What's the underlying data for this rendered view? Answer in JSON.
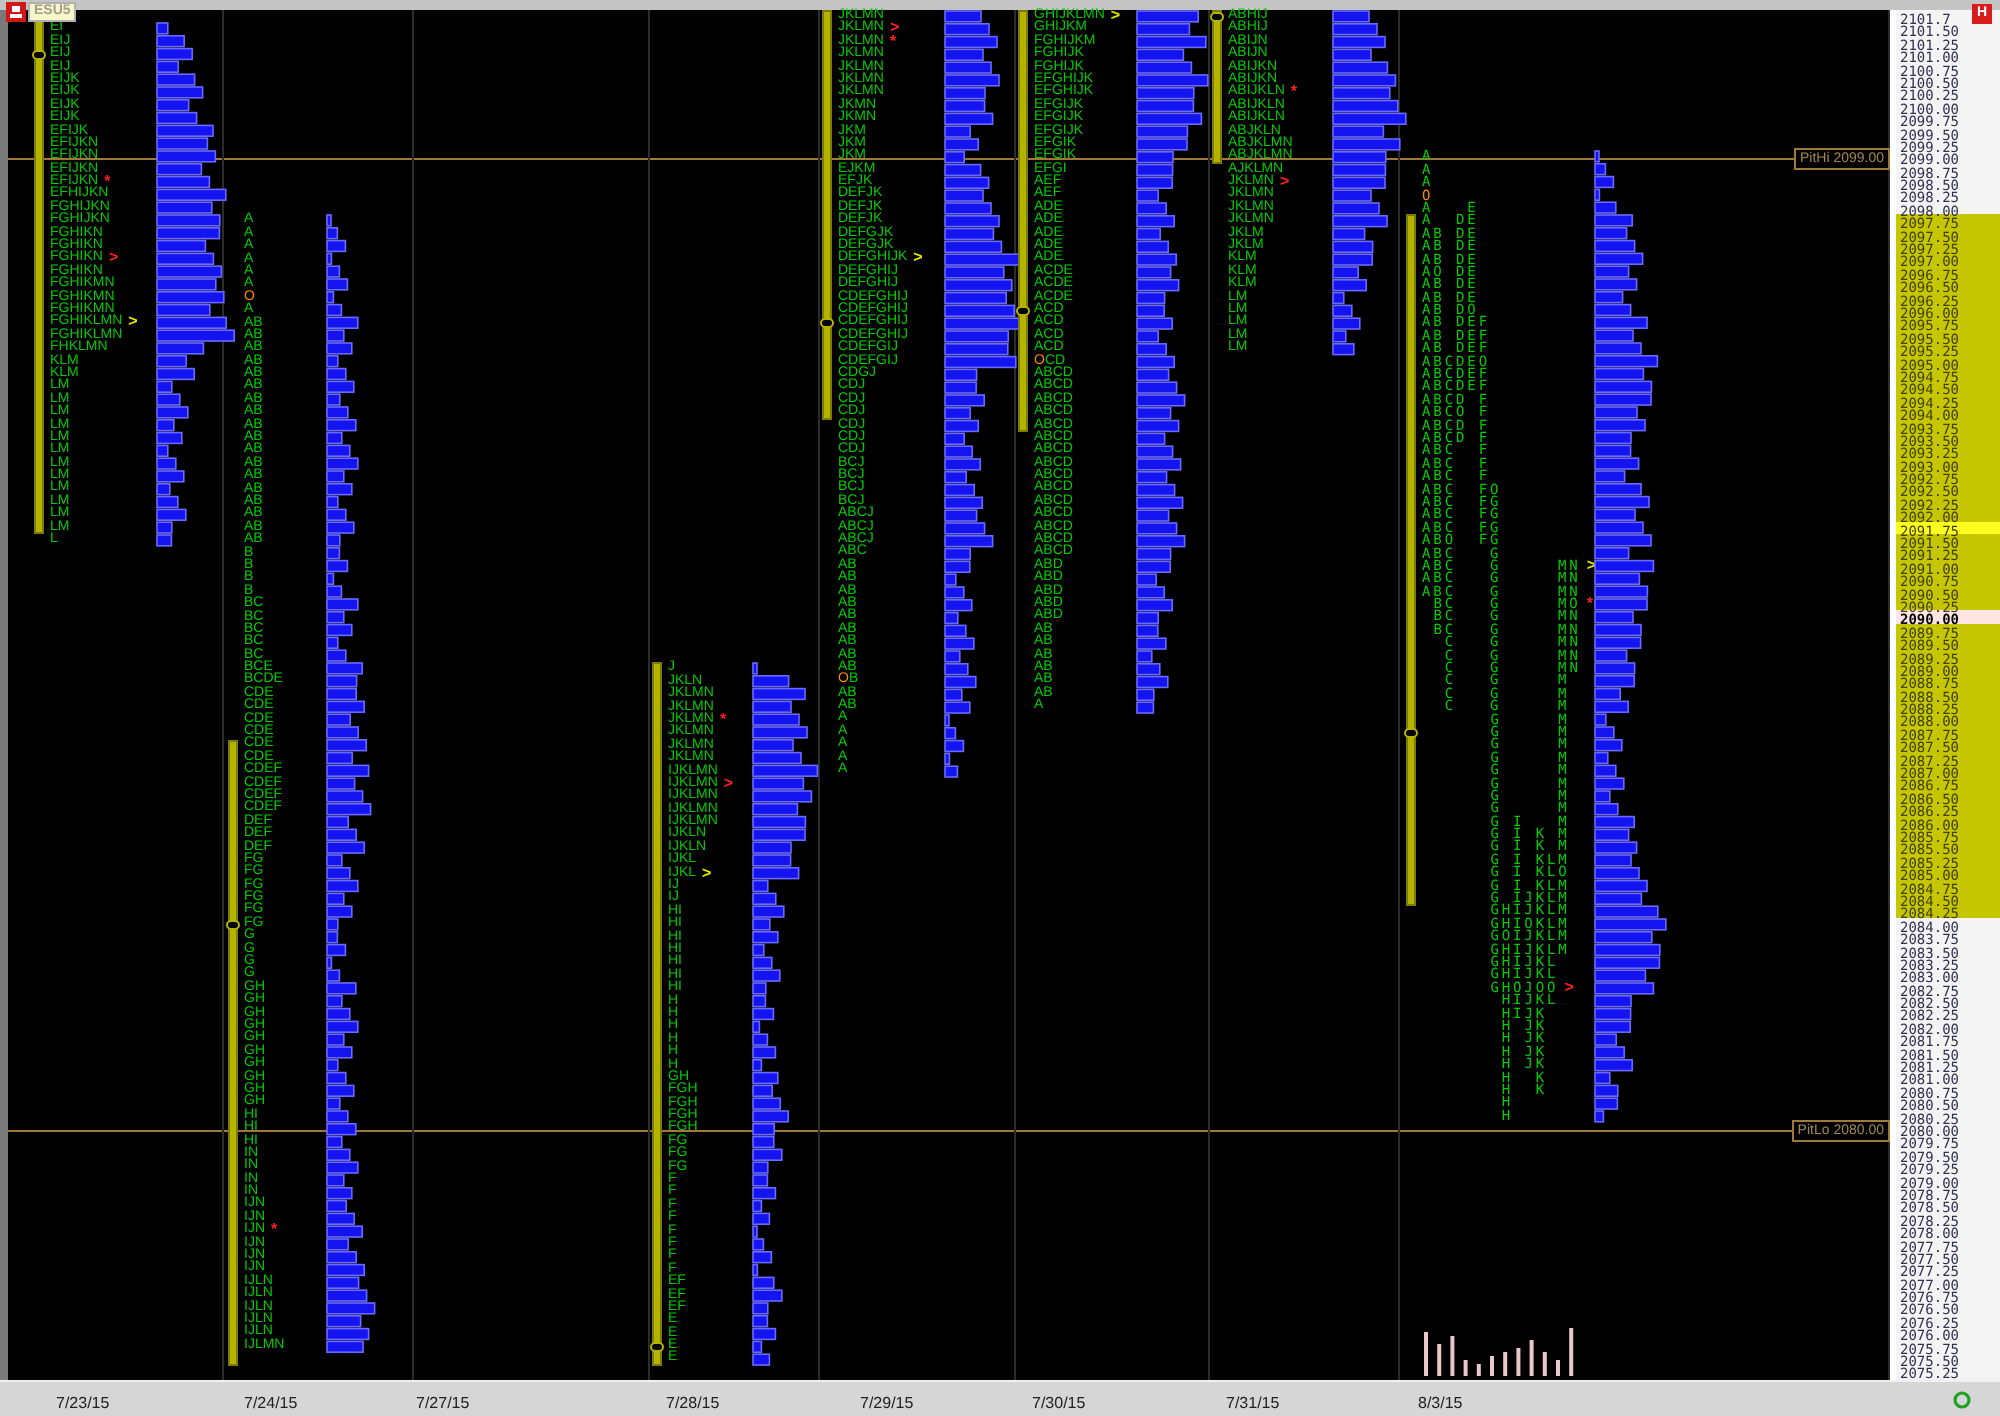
{
  "window": {
    "symbol": "ESU5",
    "button": "H"
  },
  "levels": [
    {
      "label": "PitHi 2099.00"
    },
    {
      "label": "PitLo 2080.00"
    }
  ],
  "days": [
    {
      "date": "7/23/15",
      "kind": "compact",
      "rows": [
        "EI",
        "EIJ",
        "EIJ",
        "EIJ",
        "EIJK",
        "EIJK",
        "EIJK",
        "EIJK",
        "EFIJK",
        "EFIJKN",
        "EFIJKN",
        "EFIJKN",
        {
          "tpo": "EFIJKN",
          "mark": "*",
          "color": "#ff2020"
        },
        "EFHIJKN",
        "FGHIJKN",
        "FGHIJKN",
        "FGHIKN",
        "FGHIKN",
        {
          "tpo": "FGHIKN",
          "mark": ">",
          "color": "#ff2020"
        },
        "FGHIKN",
        "FGHIKMN",
        "FGHIKMN",
        "FGHIKMN",
        {
          "tpo": "FGHIKLMN",
          "mark": ">",
          "color": "#e8e800"
        },
        "FGHIKLMN",
        "FHKLMN",
        "KLM",
        "KLM",
        "LM",
        "LM",
        "LM",
        "LM",
        "LM",
        "LM",
        "LM",
        "LM",
        "LM",
        "LM",
        "LM",
        "LM",
        "L"
      ]
    },
    {
      "date": "7/24/15",
      "kind": "compact",
      "rows": [
        "A",
        "A",
        "A",
        "A",
        "A",
        "A",
        {
          "tpo": "O",
          "open": true
        },
        "A",
        "AB",
        "AB",
        "AB",
        "AB",
        "AB",
        "AB",
        "AB",
        "AB",
        "AB",
        "AB",
        "AB",
        "AB",
        "AB",
        "AB",
        "AB",
        "AB",
        "AB",
        "AB",
        "B",
        "B",
        "B",
        "B",
        "BC",
        "BC",
        "BC",
        "BC",
        "BC",
        "BCE",
        "BCDE",
        "CDE",
        "CDE",
        "CDE",
        "CDE",
        "CDE",
        "CDE",
        "CDEF",
        "CDEF",
        "CDEF",
        "CDEF",
        "DEF",
        "DEF",
        "DEF",
        "FG",
        "FG",
        "FG",
        "FG",
        "FG",
        "FG",
        "G",
        "G",
        "G",
        "G",
        "GH",
        "GH",
        "GH",
        "GH",
        "GH",
        "GH",
        "GH",
        "GH",
        "GH",
        "GH",
        "HI",
        "HI",
        "HI",
        "IN",
        "IN",
        "IN",
        "IN",
        "IJN",
        "IJN",
        {
          "tpo": "IJN",
          "mark": "*",
          "color": "#ff2020"
        },
        "IJN",
        "IJN",
        "IJN",
        "IJLN",
        "IJLN",
        "IJLN",
        "IJLN",
        "IJLN",
        "IJLMN"
      ]
    },
    {
      "date": "7/27/15"
    },
    {
      "date": "7/28/15",
      "kind": "compact",
      "rows": [
        "J",
        "JKLN",
        "JKLMN",
        "JKLMN",
        {
          "tpo": "JKLMN",
          "mark": "*",
          "color": "#ff2020"
        },
        "JKLMN",
        "JKLMN",
        "JKLMN",
        "IJKLMN",
        {
          "tpo": "IJKLMN",
          "mark": ">",
          "color": "#ff2020"
        },
        "IJKLMN",
        "IJKLMN",
        "IJKLMN",
        "IJKLN",
        "IJKLN",
        "IJKL",
        {
          "tpo": "IJKL",
          "mark": ">",
          "color": "#e8e800"
        },
        "IJ",
        "IJ",
        "HI",
        "HI",
        "HI",
        "HI",
        "HI",
        "HI",
        "HI",
        "H",
        "H",
        "H",
        "H",
        "H",
        "H",
        "GH",
        "FGH",
        "FGH",
        "FGH",
        "FGH",
        "FG",
        "FG",
        "FG",
        "F",
        "F",
        "F",
        "F",
        "F",
        "F",
        "F",
        "F",
        "EF",
        "EF",
        "EF",
        "E",
        "E",
        "E",
        "E"
      ]
    },
    {
      "date": "7/29/15",
      "kind": "compact",
      "rows": [
        "JKLMN",
        {
          "tpo": "JKLMN",
          "mark": ">",
          "color": "#ff2020"
        },
        {
          "tpo": "JKLMN",
          "mark": "*",
          "color": "#ff2020"
        },
        "JKLMN",
        "JKLMN",
        "JKLMN",
        "JKLMN",
        "JKMN",
        "JKMN",
        "JKM",
        "JKM",
        "JKM",
        "EJKM",
        "EFJK",
        "DEFJK",
        "DEFJK",
        "DEFJK",
        "DEFGJK",
        "DEFGJK",
        {
          "tpo": "DEFGHIJK",
          "mark": ">",
          "color": "#e8e800"
        },
        "DEFGHIJ",
        "DEFGHIJ",
        "CDEFGHIJ",
        "CDEFGHIJ",
        "CDEFGHIJ",
        "CDEFGHIJ",
        "CDEFGIJ",
        "CDEFGIJ",
        "CDGJ",
        "CDJ",
        "CDJ",
        "CDJ",
        "CDJ",
        "CDJ",
        "CDJ",
        "BCJ",
        "BCJ",
        "BCJ",
        "BCJ",
        "ABCJ",
        "ABCJ",
        "ABCJ",
        "ABC",
        "AB",
        "AB",
        "AB",
        "AB",
        "AB",
        "AB",
        "AB",
        "AB",
        "AB",
        {
          "tpo": "OB",
          "open": true
        },
        "AB",
        "AB",
        "A",
        "A",
        "A",
        "A",
        "A"
      ]
    },
    {
      "date": "7/30/15",
      "kind": "compact",
      "rows": [
        {
          "tpo": "GHIJKLMN",
          "mark": ">",
          "color": "#e8e800"
        },
        "GHIJKM",
        "FGHIJKM",
        "FGHIJK",
        "FGHIJK",
        "EFGHIJK",
        "EFGHIJK",
        "EFGIJK",
        "EFGIJK",
        "EFGIJK",
        "EFGIK",
        "EFGIK",
        "EFGI",
        "AEF",
        "AEF",
        "ADE",
        "ADE",
        "ADE",
        "ADE",
        "ADE",
        "ACDE",
        "ACDE",
        "ACDE",
        "ACD",
        "ACD",
        "ACD",
        "ACD",
        {
          "tpo": "OCD",
          "open": true
        },
        "ABCD",
        "ABCD",
        "ABCD",
        "ABCD",
        "ABCD",
        "ABCD",
        "ABCD",
        "ABCD",
        "ABCD",
        "ABCD",
        "ABCD",
        "ABCD",
        "ABCD",
        "ABCD",
        "ABCD",
        "ABD",
        "ABD",
        "ABD",
        "ABD",
        "ABD",
        "AB",
        "AB",
        "AB",
        "AB",
        "AB",
        "AB",
        "A"
      ]
    },
    {
      "date": "7/31/15",
      "kind": "compact",
      "rows": [
        "ABHIJ",
        "ABHIJ",
        "ABIJN",
        "ABIJN",
        "ABIJKN",
        "ABIJKN",
        {
          "tpo": "ABIJKLN",
          "mark": "*",
          "color": "#ff2020"
        },
        "ABIJKLN",
        "ABIJKLN",
        "ABJKLN",
        "ABJKLMN",
        "ABJKLMN",
        "AJKLMN",
        {
          "tpo": "JKLMN",
          "mark": ">",
          "color": "#ff2020"
        },
        "JKLMN",
        "JKLMN",
        "JKLMN",
        "JKLM",
        "JKLM",
        "KLM",
        "KLM",
        "KLM",
        "LM",
        "LM",
        "LM",
        "LM",
        "LM"
      ]
    },
    {
      "date": "8/3/15",
      "kind": "columns",
      "volume_bars": true,
      "rows": [
        "A",
        "A",
        "A",
        {
          "tpo": "O",
          "open": true
        },
        "A   E",
        "A  DE",
        "AB DE",
        "AB DE",
        "AB DE",
        "AO DE",
        "AB DE",
        "AB DE",
        "AB DO",
        "AB DEF",
        "AB DEF",
        "AB DEF",
        "ABCDEO",
        "ABCDEF",
        "ABCDEF",
        "ABCD F",
        "ABCO F",
        "ABCD F",
        "ABCD F",
        "ABC  F",
        "ABC  F",
        "ABC  F",
        "ABC  FO",
        "ABC  FG",
        "ABC  FG",
        "ABC  FG",
        "ABO  FG",
        "ABC   G",
        {
          "tpo": "ABC   G     MN",
          "mark": ">",
          "color": "#e8e800"
        },
        "ABC   G     MN",
        "ABC   G     MN",
        {
          "tpo": " BC   G     MO",
          "mark": "*",
          "color": "#ff2020"
        },
        " BC   G     MN",
        " BC   G     MN",
        "  C   G     MN",
        "  C   G     MN",
        "  C   G     MN",
        "  C   G     M",
        "  C   G     M",
        "  C   G     M",
        "      G     M",
        "      G     M",
        "      G     M",
        "      G     M",
        "      G     M",
        "      G     M",
        "      G     M",
        "      G     M",
        "      G I   M",
        "      G I K M",
        "      G I K M",
        "      G I KLM",
        "      G I KLO",
        "      G I KLM",
        "      G IJKLM",
        "      GHIJKLM",
        "      GHIOKLM",
        "      GOIJKLM",
        "      GHIJKLM",
        "      GHIJKL",
        "      GHIJKL",
        {
          "tpo": "      GHOJOO",
          "mark": ">",
          "color": "#ff2020"
        },
        "       HIJKL",
        "       HIJK",
        "       H JK",
        "       H JK",
        "       H JK",
        "       H JK",
        "       H  K",
        "       H  K",
        "       H",
        "       H"
      ]
    }
  ],
  "axis": {
    "labels": [
      {
        "price": "2101.7",
        "kind": "plain"
      },
      {
        "price": "2101.50",
        "kind": "plain"
      },
      {
        "price": "2101.25",
        "kind": "plain"
      },
      {
        "price": "2101.00",
        "kind": "plain"
      },
      {
        "price": "2100.75",
        "kind": "plain"
      },
      {
        "price": "2100.50",
        "kind": "plain"
      },
      {
        "price": "2100.25",
        "kind": "plain"
      },
      {
        "price": "2100.00",
        "kind": "plain"
      },
      {
        "price": "2099.75",
        "kind": "plain"
      },
      {
        "price": "2099.50",
        "kind": "plain"
      },
      {
        "price": "2099.25",
        "kind": "plain"
      },
      {
        "price": "2099.00",
        "kind": "plain"
      },
      {
        "price": "2098.75",
        "kind": "plain"
      },
      {
        "price": "2098.50",
        "kind": "plain"
      },
      {
        "price": "2098.25",
        "kind": "plain"
      },
      {
        "price": "2098.00",
        "kind": "plain"
      },
      {
        "price": "2097.75",
        "kind": "value"
      },
      {
        "price": "2097.50",
        "kind": "value"
      },
      {
        "price": "2097.25",
        "kind": "value"
      },
      {
        "price": "2097.00",
        "kind": "value"
      },
      {
        "price": "2096.75",
        "kind": "value"
      },
      {
        "price": "2096.50",
        "kind": "value"
      },
      {
        "price": "2096.25",
        "kind": "value"
      },
      {
        "price": "2096.00",
        "kind": "value"
      },
      {
        "price": "2095.75",
        "kind": "value"
      },
      {
        "price": "2095.50",
        "kind": "value"
      },
      {
        "price": "2095.25",
        "kind": "value"
      },
      {
        "price": "2095.00",
        "kind": "value"
      },
      {
        "price": "2094.75",
        "kind": "value"
      },
      {
        "price": "2094.50",
        "kind": "value"
      },
      {
        "price": "2094.25",
        "kind": "value"
      },
      {
        "price": "2094.00",
        "kind": "value"
      },
      {
        "price": "2093.75",
        "kind": "value"
      },
      {
        "price": "2093.50",
        "kind": "value"
      },
      {
        "price": "2093.25",
        "kind": "value"
      },
      {
        "price": "2093.00",
        "kind": "value"
      },
      {
        "price": "2092.75",
        "kind": "value"
      },
      {
        "price": "2092.50",
        "kind": "value"
      },
      {
        "price": "2092.25",
        "kind": "value"
      },
      {
        "price": "2092.00",
        "kind": "value"
      },
      {
        "price": "2091.75",
        "kind": "bright"
      },
      {
        "price": "2091.50",
        "kind": "value"
      },
      {
        "price": "2091.25",
        "kind": "value"
      },
      {
        "price": "2091.00",
        "kind": "value"
      },
      {
        "price": "2090.75",
        "kind": "value"
      },
      {
        "price": "2090.50",
        "kind": "value"
      },
      {
        "price": "2090.25",
        "kind": "value"
      },
      {
        "price": "2090.00",
        "kind": "last"
      },
      {
        "price": "2089.75",
        "kind": "value"
      },
      {
        "price": "2089.50",
        "kind": "value"
      },
      {
        "price": "2089.25",
        "kind": "value"
      },
      {
        "price": "2089.00",
        "kind": "value"
      },
      {
        "price": "2088.75",
        "kind": "value"
      },
      {
        "price": "2088.50",
        "kind": "value"
      },
      {
        "price": "2088.25",
        "kind": "value"
      },
      {
        "price": "2088.00",
        "kind": "value"
      },
      {
        "price": "2087.75",
        "kind": "value"
      },
      {
        "price": "2087.50",
        "kind": "value"
      },
      {
        "price": "2087.25",
        "kind": "value"
      },
      {
        "price": "2087.00",
        "kind": "value"
      },
      {
        "price": "2086.75",
        "kind": "value"
      },
      {
        "price": "2086.50",
        "kind": "value"
      },
      {
        "price": "2086.25",
        "kind": "value"
      },
      {
        "price": "2086.00",
        "kind": "value"
      },
      {
        "price": "2085.75",
        "kind": "value"
      },
      {
        "price": "2085.50",
        "kind": "value"
      },
      {
        "price": "2085.25",
        "kind": "value"
      },
      {
        "price": "2085.00",
        "kind": "value"
      },
      {
        "price": "2084.75",
        "kind": "value"
      },
      {
        "price": "2084.50",
        "kind": "value"
      },
      {
        "price": "2084.25",
        "kind": "value"
      },
      {
        "price": "2084.00",
        "kind": "plain"
      },
      {
        "price": "2083.75",
        "kind": "plain"
      },
      {
        "price": "2083.50",
        "kind": "plain"
      },
      {
        "price": "2083.25",
        "kind": "plain"
      },
      {
        "price": "2083.00",
        "kind": "plain"
      },
      {
        "price": "2082.75",
        "kind": "plain"
      },
      {
        "price": "2082.50",
        "kind": "plain"
      },
      {
        "price": "2082.25",
        "kind": "plain"
      },
      {
        "price": "2082.00",
        "kind": "plain"
      },
      {
        "price": "2081.75",
        "kind": "plain"
      },
      {
        "price": "2081.50",
        "kind": "plain"
      },
      {
        "price": "2081.25",
        "kind": "plain"
      },
      {
        "price": "2081.00",
        "kind": "plain"
      },
      {
        "price": "2080.75",
        "kind": "plain"
      },
      {
        "price": "2080.50",
        "kind": "plain"
      },
      {
        "price": "2080.25",
        "kind": "plain"
      },
      {
        "price": "2080.00",
        "kind": "plain"
      },
      {
        "price": "2079.75",
        "kind": "plain"
      },
      {
        "price": "2079.50",
        "kind": "plain"
      },
      {
        "price": "2079.25",
        "kind": "plain"
      },
      {
        "price": "2079.00",
        "kind": "plain"
      },
      {
        "price": "2078.75",
        "kind": "plain"
      },
      {
        "price": "2078.50",
        "kind": "plain"
      },
      {
        "price": "2078.25",
        "kind": "plain"
      },
      {
        "price": "2078.00",
        "kind": "plain"
      },
      {
        "price": "2077.75",
        "kind": "plain"
      },
      {
        "price": "2077.50",
        "kind": "plain"
      },
      {
        "price": "2077.25",
        "kind": "plain"
      },
      {
        "price": "2077.00",
        "kind": "plain"
      },
      {
        "price": "2076.75",
        "kind": "plain"
      },
      {
        "price": "2076.50",
        "kind": "plain"
      },
      {
        "price": "2076.25",
        "kind": "plain"
      },
      {
        "price": "2076.00",
        "kind": "plain"
      },
      {
        "price": "2075.75",
        "kind": "plain"
      },
      {
        "price": "2075.50",
        "kind": "plain"
      },
      {
        "price": "2075.25",
        "kind": "plain"
      }
    ]
  }
}
